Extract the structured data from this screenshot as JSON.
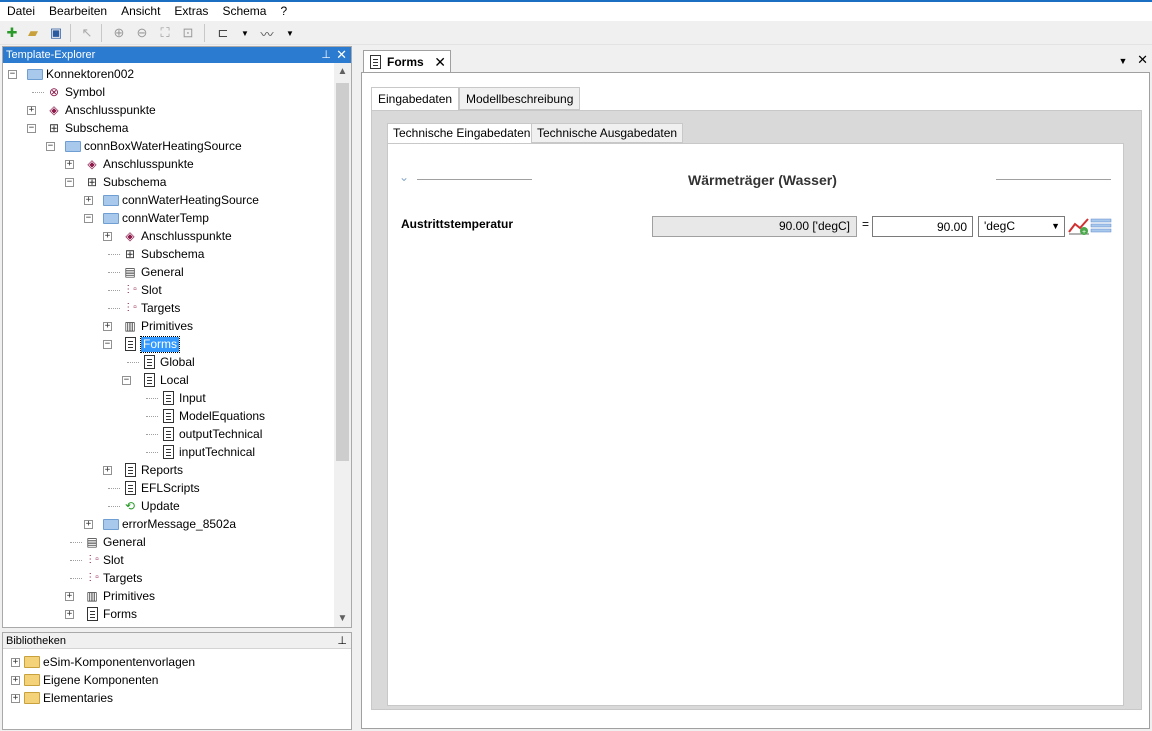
{
  "menu": [
    "Datei",
    "Bearbeiten",
    "Ansicht",
    "Extras",
    "Schema",
    "?"
  ],
  "explorer": {
    "title": "Template-Explorer",
    "tree": [
      {
        "label": "Konnektoren002",
        "level": 0,
        "icon": "folder-icon",
        "expander": "-",
        "y": 0
      },
      {
        "label": "Symbol",
        "level": 1,
        "icon": "symbol-icon",
        "expander": "",
        "y": 1
      },
      {
        "label": "Anschlusspunkte",
        "level": 1,
        "icon": "connector-icon",
        "expander": "+",
        "y": 2
      },
      {
        "label": "Subschema",
        "level": 1,
        "icon": "subschema-icon",
        "expander": "-",
        "y": 3
      },
      {
        "label": "connBoxWaterHeatingSource",
        "level": 2,
        "icon": "folder-icon",
        "expander": "-",
        "y": 4
      },
      {
        "label": "Anschlusspunkte",
        "level": 3,
        "icon": "connector-icon",
        "expander": "+",
        "y": 5
      },
      {
        "label": "Subschema",
        "level": 3,
        "icon": "subschema-icon",
        "expander": "-",
        "y": 6
      },
      {
        "label": "connWaterHeatingSource",
        "level": 4,
        "icon": "folder-icon",
        "expander": "+",
        "y": 7
      },
      {
        "label": "connWaterTemp",
        "level": 4,
        "icon": "folder-icon",
        "expander": "-",
        "y": 8
      },
      {
        "label": "Anschlusspunkte",
        "level": 5,
        "icon": "connector-icon",
        "expander": "+",
        "y": 9
      },
      {
        "label": "Subschema",
        "level": 5,
        "icon": "subschema-icon",
        "expander": "",
        "y": 10
      },
      {
        "label": "General",
        "level": 5,
        "icon": "general-icon",
        "expander": "",
        "y": 11
      },
      {
        "label": "Slot",
        "level": 5,
        "icon": "slot-icon",
        "expander": "",
        "y": 12
      },
      {
        "label": "Targets",
        "level": 5,
        "icon": "targets-icon",
        "expander": "",
        "y": 13
      },
      {
        "label": "Primitives",
        "level": 5,
        "icon": "primitives-icon",
        "expander": "+",
        "y": 14
      },
      {
        "label": "Forms",
        "level": 5,
        "icon": "forms-icon",
        "expander": "-",
        "y": 15,
        "selected": true
      },
      {
        "label": "Global",
        "level": 6,
        "icon": "form-icon",
        "expander": "",
        "y": 16
      },
      {
        "label": "Local",
        "level": 6,
        "icon": "form-icon",
        "expander": "-",
        "y": 17
      },
      {
        "label": "Input",
        "level": 7,
        "icon": "doc-icon",
        "expander": "",
        "y": 18
      },
      {
        "label": "ModelEquations",
        "level": 7,
        "icon": "doc-icon",
        "expander": "",
        "y": 19
      },
      {
        "label": "outputTechnical",
        "level": 7,
        "icon": "doc-icon",
        "expander": "",
        "y": 20
      },
      {
        "label": "inputTechnical",
        "level": 7,
        "icon": "doc-icon",
        "expander": "",
        "y": 21
      },
      {
        "label": "Reports",
        "level": 5,
        "icon": "reports-icon",
        "expander": "+",
        "y": 22
      },
      {
        "label": "EFLScripts",
        "level": 5,
        "icon": "doc-icon",
        "expander": "",
        "y": 23
      },
      {
        "label": "Update",
        "level": 5,
        "icon": "update-icon",
        "expander": "",
        "y": 24
      },
      {
        "label": "errorMessage_8502a",
        "level": 4,
        "icon": "folder-icon",
        "expander": "+",
        "y": 25
      },
      {
        "label": "General",
        "level": 3,
        "icon": "general-icon",
        "expander": "",
        "y": 26
      },
      {
        "label": "Slot",
        "level": 3,
        "icon": "slot-icon",
        "expander": "",
        "y": 27
      },
      {
        "label": "Targets",
        "level": 3,
        "icon": "targets-icon",
        "expander": "",
        "y": 28
      },
      {
        "label": "Primitives",
        "level": 3,
        "icon": "primitives-icon",
        "expander": "+",
        "y": 29
      },
      {
        "label": "Forms",
        "level": 3,
        "icon": "forms-icon",
        "expander": "+",
        "y": 30
      }
    ]
  },
  "libraries": {
    "title": "Bibliotheken",
    "items": [
      "eSim-Komponentenvorlagen",
      "Eigene Komponenten",
      "Elementaries"
    ]
  },
  "document": {
    "tab_label": "Forms",
    "tabs": [
      "Eingabedaten",
      "Modellbeschreibung"
    ],
    "subtabs": [
      "Technische Eingabedaten",
      "Technische Ausgabedaten"
    ],
    "section_title": "Wärmeträger (Wasser)",
    "param_label": "Austrittstemperatur",
    "readonly_value": "90.00 ['degC]",
    "equals": "=",
    "input_value": "90.00",
    "unit": "'degC"
  }
}
